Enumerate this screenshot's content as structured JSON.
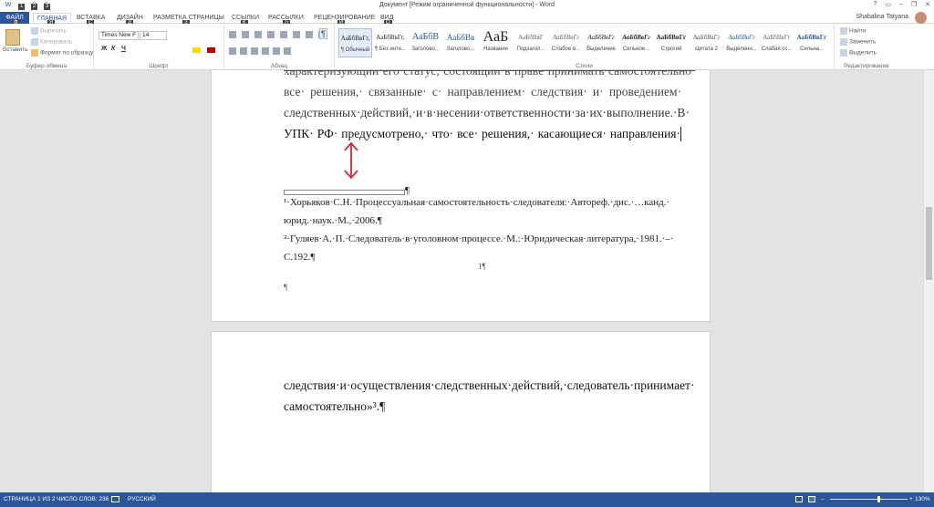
{
  "window": {
    "title": "Документ [Режим ограниченной функциональности] - Word",
    "user": "Shabalina Tatyana",
    "controls": [
      "?",
      "▭",
      "–",
      "❐",
      "✕"
    ],
    "qat_keytips": [
      "1",
      "2",
      "3"
    ]
  },
  "tabs": [
    {
      "label": "ФАЙЛ",
      "keytip": "Ф"
    },
    {
      "label": "ГЛАВНАЯ",
      "keytip": "Я"
    },
    {
      "label": "ВСТАВКА",
      "keytip": "С"
    },
    {
      "label": "ДИЗАЙН",
      "keytip": "Д"
    },
    {
      "label": "РАЗМЕТКА СТРАНИЦЫ",
      "keytip": "З"
    },
    {
      "label": "ССЫЛКИ",
      "keytip": "К"
    },
    {
      "label": "РАССЫЛКИ",
      "keytip": "Л"
    },
    {
      "label": "РЕЦЕНЗИРОВАНИЕ",
      "keytip": "И"
    },
    {
      "label": "ВИД",
      "keytip": "О"
    }
  ],
  "ribbon": {
    "clipboard": {
      "label": "Буфер обмена",
      "paste": "Вставить",
      "cut": "Вырезать",
      "copy": "Копировать",
      "format_painter": "Формат по образцу"
    },
    "font": {
      "label": "Шрифт",
      "font_name": "Times New F",
      "font_size": "14",
      "bold": "Ж",
      "italic": "К",
      "underline": "Ч"
    },
    "paragraph": {
      "label": "Абзац",
      "pilcrow": "¶"
    },
    "styles": {
      "label": "Стили",
      "items": [
        {
          "sample": "АаБбВвГг,",
          "name": "¶ Обычный"
        },
        {
          "sample": "АаБбВвГг,",
          "name": "¶ Без инте..."
        },
        {
          "sample": "АаБбВ",
          "name": "Заголово..."
        },
        {
          "sample": "АаБбВв",
          "name": "Заголово..."
        },
        {
          "sample": "АаБ",
          "name": "Название"
        },
        {
          "sample": "АаБбВвГ",
          "name": "Подзагол..."
        },
        {
          "sample": "АаБбВвГг",
          "name": "Слабое в..."
        },
        {
          "sample": "АаБбВвГг",
          "name": "Выделение"
        },
        {
          "sample": "АаБбВвГг",
          "name": "Сильное..."
        },
        {
          "sample": "АаБбВвГг",
          "name": "Строгий"
        },
        {
          "sample": "АаБбВвГг",
          "name": "Цитата 2"
        },
        {
          "sample": "АаБбВвГг",
          "name": "Выделени..."
        },
        {
          "sample": "АаБбВвГг",
          "name": "Слабая сс..."
        },
        {
          "sample": "АаБбВвГг",
          "name": "Сильна..."
        }
      ]
    },
    "editing": {
      "label": "Редактирование",
      "find": "Найти",
      "replace": "Заменить",
      "select": "Выделить"
    }
  },
  "document": {
    "page1_lines": [
      "характеризующий·его·статус,·состоящий·в·праве·принимать·самостоятельно·",
      "все·  решения,·  связанные·  с·  направлением·  следствия·  и·  проведением·",
      "следственных·действий,·и·в·несении·ответственности·за·их·выполнение.·В·",
      "УПК·  РФ·  предусмотрено,·  что·  все·  решения,·  касающиеся·  направления·"
    ],
    "footnote_sep_mark": "¶",
    "footnotes": [
      "¹·Хорьяков·С.Н.·Процессуальная·самостоятельность·следователя:·Автореф.·дис.·…канд.·",
      "юрид.·наук.·М.,·2006.¶",
      "²·Гуляев·А.·П.·Следователь·в·уголовном·процессе.·М.:·Юридическая·литература,·1981.·–·",
      "С.192.¶"
    ],
    "page_number": "1¶",
    "empty_para": "¶",
    "page2_lines": [
      "следствия·и·осуществления·следственных·действий,·следователь·принимает·",
      "самостоятельно»³.¶"
    ]
  },
  "status": {
    "page": "СТРАНИЦА 1 ИЗ 2",
    "words": "ЧИСЛО СЛОВ: 236",
    "language": "РУССКИЙ",
    "zoom": "130%",
    "zoom_level": 0.62
  },
  "colors": {
    "accent": "#2b579a",
    "arrow": "#d12a3a"
  }
}
